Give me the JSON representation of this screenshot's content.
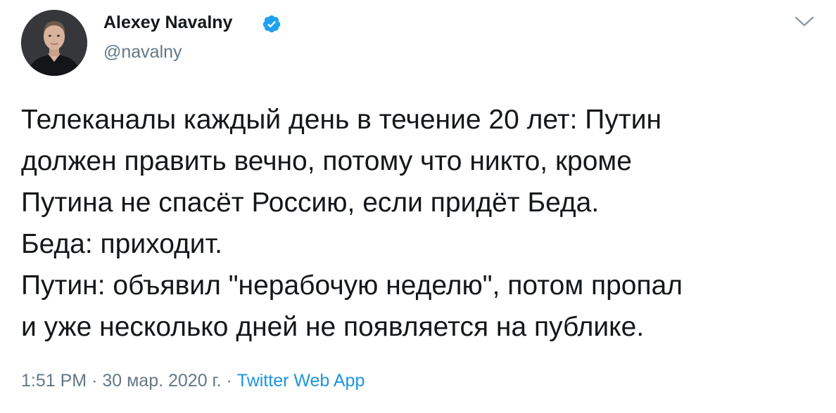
{
  "user": {
    "display_name": "Alexey Navalny",
    "handle": "@navalny",
    "verified_icon": "verified-badge-icon",
    "avatar": "profile-photo"
  },
  "header": {
    "menu_icon": "chevron-down-icon"
  },
  "tweet": {
    "lines": [
      "Телеканалы каждый день в течение 20 лет: Путин",
      "должен править вечно, потому что никто, кроме",
      "Путина не спасёт Россию, если придёт Беда.",
      "Беда: приходит.",
      "Путин: объявил \"нерабочую неделю\", потом пропал",
      "и уже несколько дней не появляется на публике."
    ]
  },
  "meta": {
    "time": "1:51 PM",
    "separator": "·",
    "date": "30 мар. 2020 г.",
    "source": "Twitter Web App"
  },
  "colors": {
    "text": "#14171a",
    "secondary": "#657786",
    "link": "#1b95e0",
    "verified": "#1da1f2"
  }
}
